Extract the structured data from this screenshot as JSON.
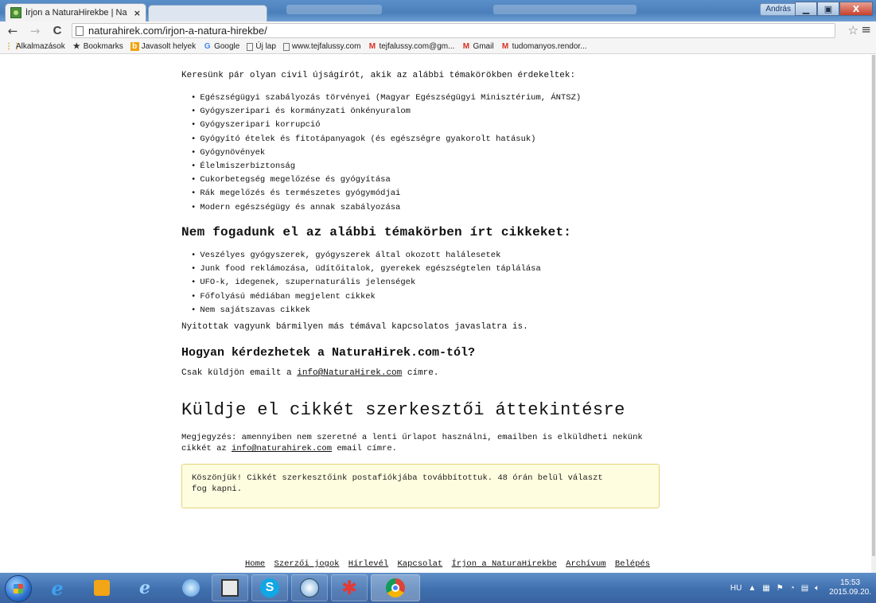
{
  "browser": {
    "tab_title": "Írjon a NaturaHirekbe | Na",
    "tab_close": "×",
    "user_name": "András",
    "window_buttons": {
      "minimize": "▁",
      "maximize": "▣",
      "close": "X"
    },
    "nav": {
      "back": "←",
      "forward": "→",
      "reload": "C"
    },
    "url": "naturahirek.com/irjon-a-natura-hirekbe/",
    "star": "☆",
    "menu": "≡"
  },
  "bookmarks": [
    {
      "label": "Alkalmazások",
      "icon": "apps-grid-icon",
      "glyph": "⋮⋮"
    },
    {
      "label": "Bookmarks",
      "icon": "star-icon",
      "glyph": "★"
    },
    {
      "label": "Javasolt helyek",
      "icon": "suggested-sites-icon",
      "glyph": "b"
    },
    {
      "label": "Google",
      "icon": "google-icon",
      "glyph": "G"
    },
    {
      "label": "Új lap",
      "icon": "page-icon",
      "glyph": ""
    },
    {
      "label": "www.tejfalussy.com",
      "icon": "page-icon",
      "glyph": ""
    },
    {
      "label": "tejfalussy.com@gm...",
      "icon": "gmail-icon",
      "glyph": "M"
    },
    {
      "label": "Gmail",
      "icon": "gmail-icon",
      "glyph": "M"
    },
    {
      "label": "tudomanyos.rendor...",
      "icon": "gmail-icon",
      "glyph": "M"
    }
  ],
  "page": {
    "intro": "Keresünk pár olyan civil újságírót, akik az alábbi témakörökben érdekeltek:",
    "wanted_topics": [
      "Egészségügyi szabályozás törvényei (Magyar Egészségügyi Minisztérium, ÁNTSZ)",
      "Gyógyszeripari és kormányzati önkényuralom",
      "Gyógyszeripari korrupció",
      "Gyógyító ételek és fitotápanyagok (és egészségre gyakorolt hatásuk)",
      "Gyógynövények",
      "Élelmiszerbiztonság",
      "Cukorbetegség megelőzése és gyógyítása",
      "Rák megelőzés és természetes gyógymódjai",
      "Modern egészségügy és annak szabályozása"
    ],
    "rejected_heading": "Nem fogadunk el az alábbi témakörben írt cikkeket:",
    "rejected_topics": [
      "Veszélyes gyógyszerek, gyógyszerek által okozott halálesetek",
      "Junk food reklámozása, üdítőitalok, gyerekek egészségtelen táplálása",
      "UFO-k, idegenek, szupernaturális jelenségek",
      "Főfolyású médiában megjelent cikkek",
      "Nem sajátszavas cikkek"
    ],
    "open_note": "Nyitottak vagyunk bármilyen más témával kapcsolatos javaslatra is.",
    "contact_heading": "Hogyan kérdezhetek a NaturaHirek.com-tól?",
    "contact_prefix": "Csak küldjön emailt a ",
    "contact_email": "info@NaturaHirek.com",
    "contact_suffix": " címre.",
    "submit_heading": "Küldje el cikkét szerkesztői áttekintésre",
    "note_line1": "Megjegyzés: amennyiben nem szeretné a lenti űrlapot használni, emailben is elküldheti nekünk",
    "note_line2_prefix": "cikkét az ",
    "note_email": "info@naturahirek.com",
    "note_line2_suffix": " email címre.",
    "success_line1": "Köszönjük! Cikkét szerkesztőink postafiókjába továbbítottuk. 48 órán belül választ",
    "success_line2": "fog kapni.",
    "success_color": "#fffde0"
  },
  "footer": [
    "Home",
    "Szerzői jogok",
    "Hírlevél",
    "Kapcsolat",
    "Írjon a NaturaHirekbe",
    "Archívum",
    "Belépés"
  ],
  "taskbar": {
    "language": "HU",
    "time": "15:53",
    "date": "2015.09.20."
  }
}
